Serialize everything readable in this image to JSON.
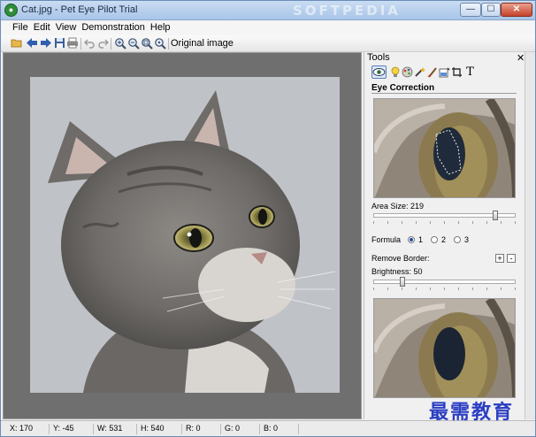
{
  "window": {
    "title": "Cat.jpg - Pet Eye Pilot Trial",
    "watermark": "SOFTPEDIA",
    "buttons": {
      "minimize": "—",
      "maximize": "☐",
      "close": "✕"
    }
  },
  "menu": [
    "File",
    "Edit",
    "View",
    "Demonstration",
    "Help"
  ],
  "toolbar": {
    "buttons": [
      "open-icon",
      "back-icon",
      "forward-icon",
      "save-icon",
      "print-icon",
      "undo-icon",
      "redo-icon",
      "zoom-in-icon",
      "zoom-out-icon",
      "zoom-fit-icon",
      "zoom-actual-icon"
    ],
    "original_image_label": "Original image"
  },
  "tools": {
    "title": "Tools",
    "close": "✕",
    "tool_icons": [
      "eye-icon",
      "bulb-icon",
      "palette-icon",
      "wand-icon",
      "brush-icon",
      "fill-icon",
      "crop-icon",
      "text-icon"
    ],
    "text_tool_glyph": "T",
    "section_title": "Eye Correction",
    "area_size_label": "Area Size: 219",
    "area_size_value": 219,
    "formula_label": "Formula",
    "formula_options": [
      "1",
      "2",
      "3"
    ],
    "formula_selected": "1",
    "remove_border_label": "Remove Border:",
    "plus": "+",
    "minus": "-",
    "brightness_label": "Brightness: 50",
    "brightness_value": 50
  },
  "status": {
    "x": "X: 170",
    "y": "Y: -45",
    "w": "W: 531",
    "h": "H: 540",
    "r": "R: 0",
    "g": "G: 0",
    "b": "B: 0"
  },
  "corner_watermark": "最需教育"
}
